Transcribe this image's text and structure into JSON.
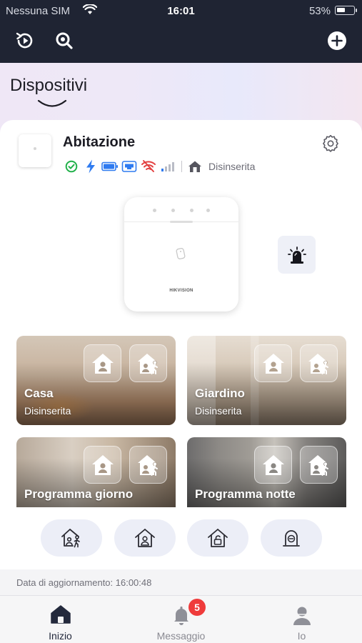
{
  "status_bar": {
    "carrier": "Nessuna SIM",
    "time": "16:01",
    "battery_percent": "53%",
    "battery_level": 0.53
  },
  "top_nav": {
    "icons": [
      "history-play-icon",
      "search-icon",
      "add-icon"
    ]
  },
  "header": {
    "title": "Dispositivi"
  },
  "device": {
    "name": "Abitazione",
    "status_icons": [
      "online-check-icon",
      "power-bolt-icon",
      "battery-icon",
      "ethernet-icon",
      "wifi-off-icon",
      "signal-bars-icon"
    ],
    "arm_status": "Disinserita",
    "hub_brand": "HIKVISION"
  },
  "areas": [
    {
      "name": "Casa",
      "status": "Disinserita"
    },
    {
      "name": "Giardino",
      "status": "Disinserita"
    },
    {
      "name": "Programma giorno",
      "status": ""
    },
    {
      "name": "Programma notte",
      "status": ""
    }
  ],
  "quick_actions": [
    "stay-arm-icon",
    "away-arm-icon",
    "disarm-icon",
    "clear-alarm-icon"
  ],
  "update": {
    "text": "Data di aggiornamento: 16:00:48"
  },
  "tabs": [
    {
      "label": "Inizio",
      "icon": "home-icon",
      "active": true
    },
    {
      "label": "Messaggio",
      "icon": "bell-icon",
      "active": false,
      "badge": "5"
    },
    {
      "label": "Io",
      "icon": "person-icon",
      "active": false
    }
  ],
  "colors": {
    "nav_background": "#1f2433",
    "accent": "#2f7bf0",
    "online_green": "#21b14a",
    "badge_red": "#ef3b3b"
  }
}
